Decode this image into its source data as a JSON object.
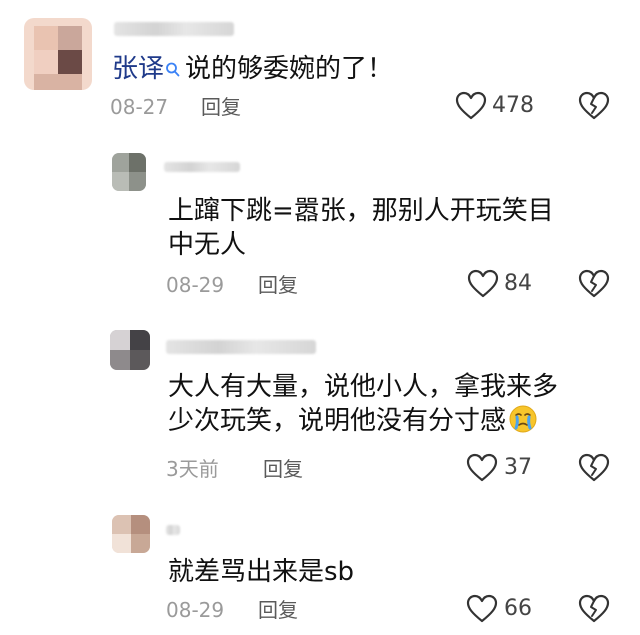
{
  "comments": [
    {
      "mention": "张译",
      "text": "说的够委婉的了！",
      "date": "08-27",
      "reply_label": "回复",
      "likes": "478"
    },
    {
      "text_lines": [
        "上蹿下跳=嚣张，那别人开玩笑目",
        "中无人"
      ],
      "date": "08-29",
      "reply_label": "回复",
      "likes": "84"
    },
    {
      "text_lines": [
        "大人有大量，说他小人，拿我来多",
        "少次玩笑，说明他没有分寸感"
      ],
      "emoji": "crying-face-emoji",
      "date": "3天前",
      "reply_label": "回复",
      "likes": "37"
    },
    {
      "text": "就差骂出来是sb",
      "date": "08-29",
      "reply_label": "回复",
      "likes": "66"
    }
  ],
  "icons": {
    "like": "heart-outline-icon",
    "dislike": "broken-heart-icon",
    "search": "search-icon"
  },
  "colors": {
    "mention": "#1f3a8a",
    "meta": "#9a9a9a",
    "text": "#111111"
  }
}
